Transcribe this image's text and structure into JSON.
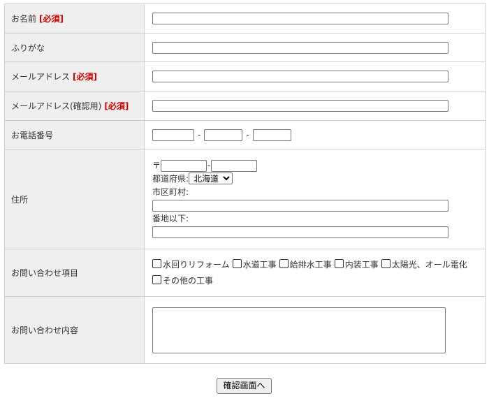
{
  "form": {
    "name": {
      "label": "お名前",
      "required": "[必須]",
      "value": ""
    },
    "furigana": {
      "label": "ふりがな",
      "value": ""
    },
    "email": {
      "label": "メールアドレス",
      "required": "[必須]",
      "value": ""
    },
    "email_confirm": {
      "label": "メールアドレス(確認用)",
      "required": "[必須]",
      "value": ""
    },
    "phone": {
      "label": "お電話番号",
      "sep": "-"
    },
    "address": {
      "label": "住所",
      "zip_mark": "〒",
      "zip_sep": "-",
      "prefecture_label": "都道府県:",
      "prefecture_value": "北海道",
      "city_label": "市区町村:",
      "street_label": "番地以下:"
    },
    "inquiry_items": {
      "label": "お問い合わせ項目",
      "options": [
        "水回りリフォーム",
        "水道工事",
        "給排水工事",
        "内装工事",
        "太陽光、オール電化",
        "その他の工事"
      ]
    },
    "inquiry_content": {
      "label": "お問い合わせ内容",
      "value": ""
    }
  },
  "submit_label": "確認画面へ"
}
